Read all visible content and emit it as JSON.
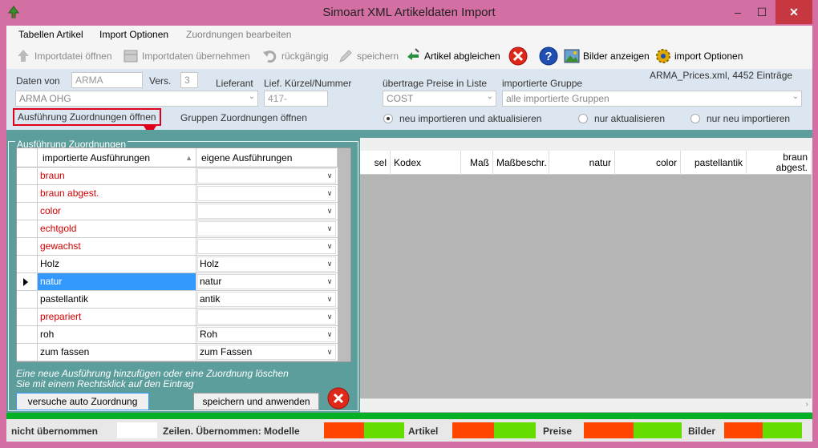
{
  "window": {
    "title": "Simoart XML Artikeldaten Import",
    "minimize": "–",
    "maximize": "☐",
    "close": "✕"
  },
  "menu": {
    "items": [
      "Tabellen Artikel",
      "Import Optionen",
      "Zuordnungen bearbeiten"
    ]
  },
  "toolbar": {
    "open_file": "Importdatei öffnen",
    "take_over": "Importdaten übernehmen",
    "undo": "rückgängig",
    "save": "speichern",
    "compare": "Artikel abgleichen",
    "show_images": "Bilder anzeigen",
    "import_options": "import Optionen"
  },
  "form": {
    "daten_von_label": "Daten von",
    "daten_von_value": "ARMA",
    "vers_label": "Vers.",
    "vers_value": "3",
    "lieferant_label": "Lieferant",
    "lieferant_value": "ARMA OHG",
    "kuerzel_label": "Lief. Kürzel/Nummer",
    "kuerzel_value": "417-",
    "preise_label": "übertrage Preise in Liste",
    "preise_value": "COST",
    "gruppe_label": "importierte Gruppe",
    "gruppe_value": "alle importierte Gruppen",
    "file_info": "ARMA_Prices.xml, 4452 Einträge",
    "btn_ausfuehrung": "Ausführung Zuordnungen öffnen",
    "btn_gruppen": "Gruppen Zuordnungen öffnen",
    "radio": [
      {
        "label": "neu importieren und aktualisieren",
        "checked": true
      },
      {
        "label": "nur aktualisieren",
        "checked": false
      },
      {
        "label": "nur neu importieren",
        "checked": false
      }
    ]
  },
  "dialog": {
    "title": "Ausführung Zuordnungen",
    "col1": "importierte Ausführungen",
    "col2": "eigene Ausführungen",
    "rows": [
      {
        "imported": "braun",
        "own": "",
        "unmapped": true,
        "selected": false
      },
      {
        "imported": "braun abgest.",
        "own": "",
        "unmapped": true,
        "selected": false
      },
      {
        "imported": "color",
        "own": "",
        "unmapped": true,
        "selected": false
      },
      {
        "imported": "echtgold",
        "own": "",
        "unmapped": true,
        "selected": false
      },
      {
        "imported": "gewachst",
        "own": "",
        "unmapped": true,
        "selected": false
      },
      {
        "imported": "Holz",
        "own": "Holz",
        "unmapped": false,
        "selected": false
      },
      {
        "imported": "natur",
        "own": "natur",
        "unmapped": false,
        "selected": true
      },
      {
        "imported": "pastellantik",
        "own": "antik",
        "unmapped": false,
        "selected": false
      },
      {
        "imported": "prepariert",
        "own": "",
        "unmapped": true,
        "selected": false
      },
      {
        "imported": "roh",
        "own": "Roh",
        "unmapped": false,
        "selected": false
      },
      {
        "imported": "zum fassen",
        "own": "zum Fassen",
        "unmapped": false,
        "selected": false
      }
    ],
    "hint_line1": "Eine neue Ausführung hinzufügen oder eine Zuordnung löschen",
    "hint_line2": "Sie mit einem Rechtsklick auf den Eintrag",
    "btn_auto": "versuche auto Zuordnung",
    "btn_save": "speichern und anwenden"
  },
  "grid": {
    "columns": [
      "sel",
      "Kodex",
      "Maß",
      "Maßbeschr.",
      "natur",
      "color",
      "pastellantik",
      "braun abgest."
    ]
  },
  "status": {
    "nicht_label": "nicht übernommen",
    "zeilen_label": "Zeilen. Übernommen: Modelle",
    "artikel_label": "Artikel",
    "preise_label": "Preise",
    "bilder_label": "Bilder"
  },
  "colors": {
    "accent_red": "#ff4500",
    "accent_green": "#66dd00",
    "teal": "#5b9e9c",
    "titlebar": "#d46fa4"
  }
}
